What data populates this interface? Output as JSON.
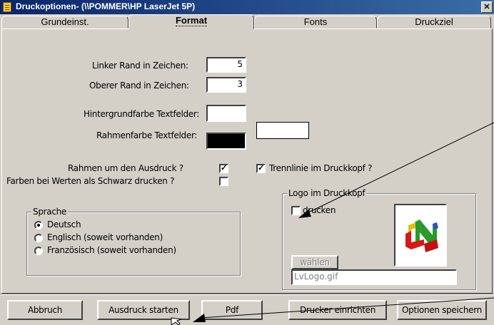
{
  "window": {
    "title": "Druckoptionen- (\\\\POMMER\\HP LaserJet 5P)",
    "close_glyph": "✕"
  },
  "tabs": [
    {
      "label": "Grundeinst."
    },
    {
      "label": "Format"
    },
    {
      "label": "Fonts"
    },
    {
      "label": "Druckziel"
    }
  ],
  "format": {
    "left_margin_label": "Linker Rand in Zeichen:",
    "left_margin_value": "5",
    "top_margin_label": "Oberer Rand in Zeichen:",
    "top_margin_value": "3",
    "bg_color_label": "Hintergrundfarbe Textfelder:",
    "bg_color": "#ffffff",
    "frame_color_label": "Rahmenfarbe Textfelder:",
    "frame_color": "#000000",
    "extra_color": "#ffffff",
    "frame_print_label": "Rahmen um den Ausdruck ?",
    "frame_print_checked": true,
    "colors_black_label": "Farben bei Werten als Schwarz drucken ?",
    "colors_black_checked": false,
    "separator_label": "Trennlinie im Druckkopf ?",
    "separator_checked": true
  },
  "language": {
    "title": "Sprache",
    "options": [
      {
        "label": "Deutsch",
        "selected": true
      },
      {
        "label": "Englisch (soweit vorhanden)",
        "selected": false
      },
      {
        "label": "Französisch (soweit vorhanden)",
        "selected": false
      }
    ]
  },
  "logo": {
    "title": "Logo im Druckkopf",
    "print_label": "drucken",
    "print_checked": false,
    "choose_label": "wählen",
    "filename": "LvLogo.gif"
  },
  "buttons": {
    "cancel": "Abbruch",
    "start_print": "Ausdruck starten",
    "pdf": "Pdf",
    "setup_printer": "Drucker einrichten",
    "save_options": "Optionen speichern"
  },
  "check_glyph": "✓"
}
